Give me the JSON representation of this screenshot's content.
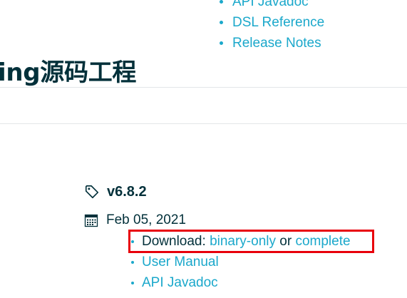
{
  "nav_links": [
    {
      "label": "API Javadoc"
    },
    {
      "label": "DSL Reference"
    },
    {
      "label": "Release Notes"
    }
  ],
  "page_title": "ing源码工程",
  "edge_mark": ":",
  "release": {
    "version": "v6.8.2",
    "date": "Feb 05, 2021",
    "download_prefix": "Download: ",
    "binary_only": "binary-only",
    "or_text": " or ",
    "complete": "complete",
    "user_manual": "User Manual",
    "api_javadoc": "API Javadoc"
  },
  "icons": {
    "tag": "tag-icon",
    "calendar": "calendar-icon"
  },
  "colors": {
    "link": "#1ba8cb",
    "text": "#02303a",
    "highlight": "#e8000b"
  }
}
